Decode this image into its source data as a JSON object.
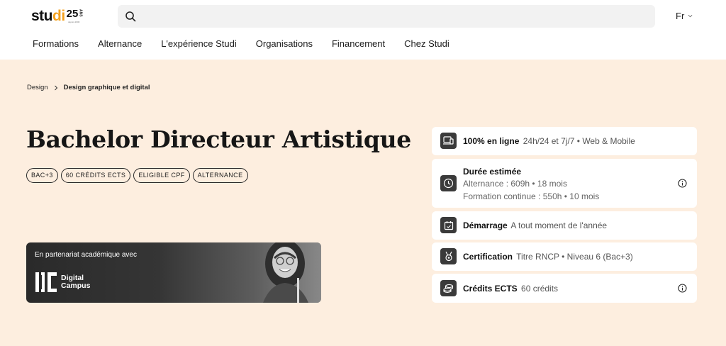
{
  "header": {
    "logo": {
      "word_a": "stu",
      "word_b": "di",
      "years": "25",
      "years_suffix": "ANS",
      "tagline": "depuis 2000"
    },
    "search": {
      "value": "",
      "placeholder": ""
    },
    "language": "Fr",
    "nav": [
      "Formations",
      "Alternance",
      "L'expérience Studi",
      "Organisations",
      "Financement",
      "Chez Studi"
    ]
  },
  "breadcrumb": {
    "parent": "Design",
    "current": "Design graphique et digital"
  },
  "page": {
    "title": "Bachelor Directeur Artistique",
    "tags": [
      "BAC+3",
      "60 CRÉDITS ECTS",
      "ELIGIBLE CPF",
      "ALTERNANCE"
    ]
  },
  "partner": {
    "label": "En partenariat académique avec",
    "name_line1": "Digital",
    "name_line2": "Campus"
  },
  "info": {
    "online": {
      "title": "100% en ligne",
      "value": "24h/24 et 7j/7 • Web & Mobile",
      "icon": "devices-icon"
    },
    "duration": {
      "title": "Durée estimée",
      "line1": "Alternance : 609h • 18 mois",
      "line2": "Formation continue : 550h • 10 mois",
      "icon": "clock-icon"
    },
    "start": {
      "title": "Démarrage",
      "value": "A tout moment de l'année",
      "icon": "calendar-icon"
    },
    "certification": {
      "title": "Certification",
      "value": "Titre RNCP • Niveau 6 (Bac+3)",
      "icon": "medal-icon"
    },
    "ects": {
      "title": "Crédits ECTS",
      "value": "60 crédits",
      "icon": "coins-icon"
    }
  },
  "colors": {
    "background": "#fdeedf",
    "accent": "#f4a11d",
    "card": "#ffffff",
    "icon_bg": "#3a3a3a"
  }
}
